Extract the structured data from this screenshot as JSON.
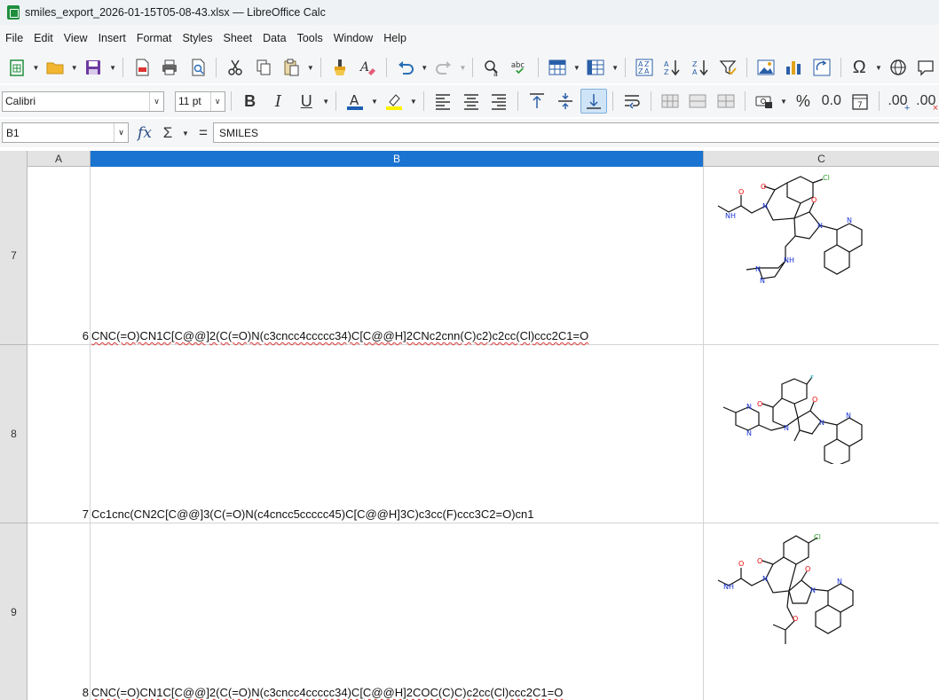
{
  "window": {
    "title": "smiles_export_2026-01-15T05-08-43.xlsx — LibreOffice Calc"
  },
  "menu": {
    "items": [
      "File",
      "Edit",
      "View",
      "Insert",
      "Format",
      "Styles",
      "Sheet",
      "Data",
      "Tools",
      "Window",
      "Help"
    ]
  },
  "toolbar": {
    "font_name": "Calibri",
    "font_size": "11 pt",
    "bold": "B",
    "italic": "I",
    "underline": "U",
    "percent": "%",
    "number_format": "0.0",
    "add_decimal": ".00",
    "del_decimal": ".00",
    "special_char": "Ω",
    "spellcheck": "abc"
  },
  "formula_bar": {
    "cell_ref": "B1",
    "fx": "fx",
    "sum": "Σ",
    "equals": "=",
    "content": "SMILES"
  },
  "sheet": {
    "columns": [
      "A",
      "B",
      "C"
    ],
    "selected_column": "B",
    "rows": [
      {
        "row_number": "7",
        "index": "6",
        "smiles": "CNC(=O)CN1C[C@@]2(C(=O)N(c3cncc4ccccc34)C[C@@H]2CNc2cnn(C)c2)c2cc(Cl)ccc2C1=O"
      },
      {
        "row_number": "8",
        "index": "7",
        "smiles": "Cc1cnc(CN2C[C@@]3(C(=O)N(c4cncc5ccccc45)C[C@@H]3C)c3cc(F)ccc3C2=O)cn1"
      },
      {
        "row_number": "9",
        "index": "8",
        "smiles": "CNC(=O)CN1C[C@@]2(C(=O)N(c3cncc4ccccc34)C[C@@H]2COC(C)C)c2cc(Cl)ccc2C1=O"
      }
    ]
  },
  "atom_labels": {
    "O": "O",
    "N": "N",
    "NH": "NH",
    "H": "H",
    "Cl": "Cl",
    "F": "F"
  }
}
